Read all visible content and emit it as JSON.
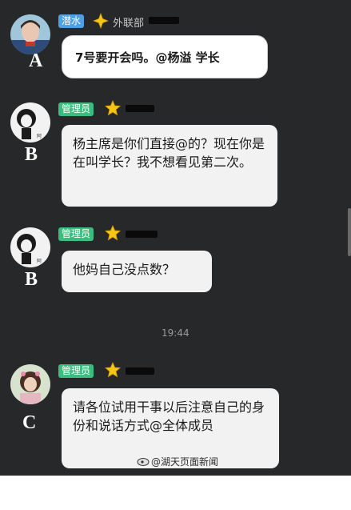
{
  "messages": [
    {
      "badge": "潜水",
      "dept": "外联部",
      "label": "A",
      "text": "7号要开会吗。@杨溢 学长"
    },
    {
      "badge": "管理员",
      "label": "B",
      "text": "杨主席是你们直接@的？现在你是在叫学长？我不想看见第二次。"
    },
    {
      "badge": "管理员",
      "label": "B",
      "text": "他妈自己没点数？"
    },
    {
      "badge": "管理员",
      "label": "C",
      "text": "请各位试用干事以后注意自己的身份和说话方式@全体成员"
    }
  ],
  "timestamp": "19:44",
  "watermark": "@湖天页面新闻",
  "colors": {
    "background": "#272829",
    "bubble": "#f2f2f2",
    "badge_dive": "#4ea0e3",
    "badge_admin": "#3bbd7f"
  },
  "icons": [
    "crown-star-icon",
    "sparkle-icon"
  ]
}
